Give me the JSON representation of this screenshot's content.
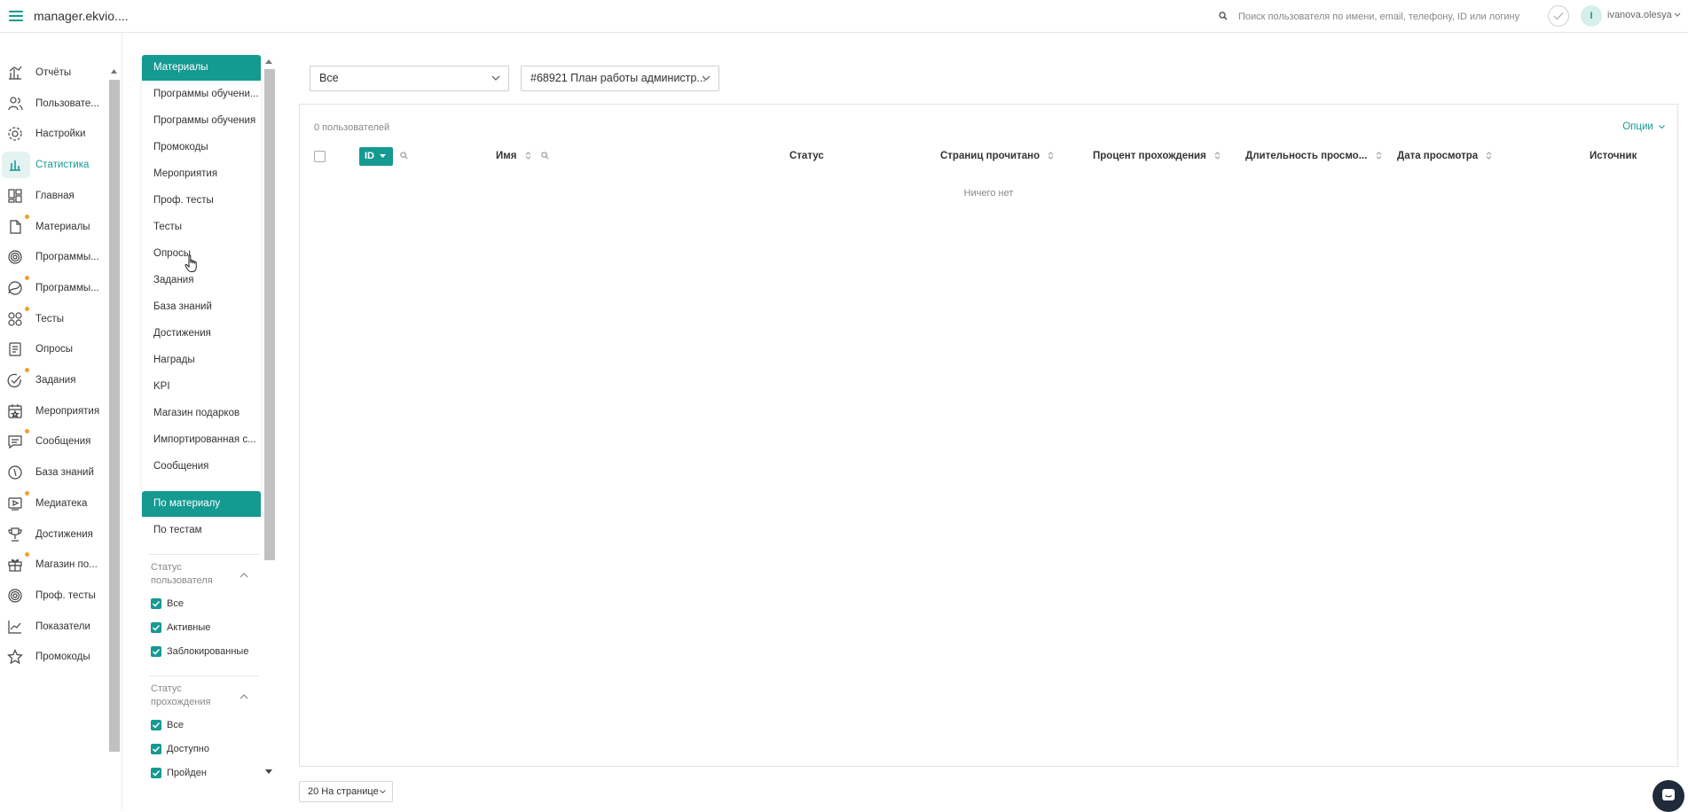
{
  "topbar": {
    "app_title": "manager.ekvio....",
    "search_placeholder": "Поиск пользователя по имени, email, телефону, ID или логину",
    "avatar_letter": "I",
    "user_name": "ivanova.olesya"
  },
  "nav": {
    "items": [
      {
        "label": "Отчёты",
        "icon": "reports-icon",
        "dot": false,
        "active": false
      },
      {
        "label": "Пользовате...",
        "icon": "users-icon",
        "dot": false,
        "active": false
      },
      {
        "label": "Настройки",
        "icon": "gear-icon",
        "dot": false,
        "active": false
      },
      {
        "label": "Статистика",
        "icon": "statistics-icon",
        "dot": false,
        "active": true
      },
      {
        "label": "Главная",
        "icon": "home-icon",
        "dot": false,
        "active": false
      },
      {
        "label": "Материалы",
        "icon": "document-icon",
        "dot": true,
        "active": false
      },
      {
        "label": "Программы...",
        "icon": "programs-icon",
        "dot": false,
        "active": false
      },
      {
        "label": "Программы...",
        "icon": "trajectory-icon",
        "dot": true,
        "active": false
      },
      {
        "label": "Тесты",
        "icon": "tests-icon",
        "dot": true,
        "active": false
      },
      {
        "label": "Опросы",
        "icon": "survey-icon",
        "dot": false,
        "active": false
      },
      {
        "label": "Задания",
        "icon": "task-icon",
        "dot": true,
        "active": false
      },
      {
        "label": "Мероприятия",
        "icon": "calendar-icon",
        "dot": false,
        "active": false
      },
      {
        "label": "Сообщения",
        "icon": "message-icon",
        "dot": true,
        "active": false
      },
      {
        "label": "База знаний",
        "icon": "knowledge-icon",
        "dot": false,
        "active": false
      },
      {
        "label": "Медиатека",
        "icon": "media-icon",
        "dot": true,
        "active": false
      },
      {
        "label": "Достижения",
        "icon": "trophy-icon",
        "dot": false,
        "active": false
      },
      {
        "label": "Магазин по...",
        "icon": "gift-icon",
        "dot": true,
        "active": false
      },
      {
        "label": "Проф. тесты",
        "icon": "prof-tests-icon",
        "dot": false,
        "active": false
      },
      {
        "label": "Показатели",
        "icon": "chart-line-icon",
        "dot": false,
        "active": false
      },
      {
        "label": "Промокоды",
        "icon": "star-icon",
        "dot": false,
        "active": false
      }
    ]
  },
  "submenu": {
    "header1": "Материалы",
    "items": [
      "Программы обучени...",
      "Программы обучения",
      "Промокоды",
      "Мероприятия",
      "Проф. тесты",
      "Тесты",
      "Опросы",
      "Задания",
      "База знаний",
      "Достижения",
      "Награды",
      "KPI",
      "Магазин подарков",
      "Импортированная с...",
      "Сообщения"
    ],
    "header2": "По материалу",
    "item_after": "По тестам"
  },
  "filters": {
    "user_status": {
      "title_line1": "Статус",
      "title_line2": "пользователя",
      "options": [
        "Все",
        "Активные",
        "Заблокированные"
      ]
    },
    "pass_status": {
      "title_line1": "Статус",
      "title_line2": "прохождения",
      "options": [
        "Все",
        "Доступно",
        "Пройден"
      ]
    }
  },
  "selects": {
    "filter_value": "Все",
    "material_value": "#68921 План работы администр..."
  },
  "table": {
    "users_count": "0 пользователей",
    "options_label": "Опции",
    "id_label": "ID",
    "columns": {
      "name": "Имя",
      "status": "Статус",
      "pages": "Страниц прочитано",
      "percent": "Процент прохождения",
      "duration": "Длительность просмо...",
      "date": "Дата просмотра",
      "source": "Источник"
    },
    "empty_text": "Ничего нет"
  },
  "pagination": {
    "per_page_label": "20 На странице"
  },
  "colors": {
    "accent": "#159a91",
    "dot": "#f0a030",
    "chat_bg": "#1f2b3a"
  }
}
